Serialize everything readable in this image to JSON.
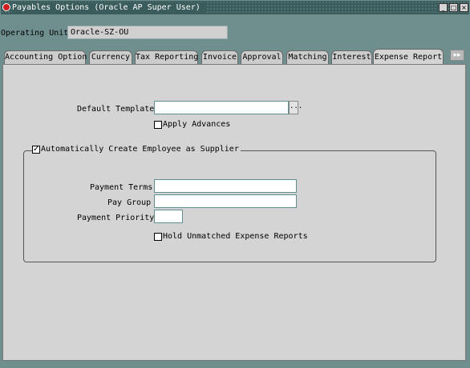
{
  "window": {
    "title": "Payables Options (Oracle AP Super User)",
    "logo": "oracle-logo-icon",
    "controls": [
      "minimize-icon",
      "maximize-icon",
      "close-icon"
    ]
  },
  "operating_unit": {
    "label": "Operating Unit",
    "value": "Oracle-SZ-OU"
  },
  "tabs": [
    {
      "label": "Accounting Option",
      "active": false
    },
    {
      "label": "Currency",
      "active": false
    },
    {
      "label": "Tax Reporting",
      "active": false
    },
    {
      "label": "Invoice",
      "active": false
    },
    {
      "label": "Approval",
      "active": false
    },
    {
      "label": "Matching",
      "active": false
    },
    {
      "label": "Interest",
      "active": false
    },
    {
      "label": "Expense Report",
      "active": true
    }
  ],
  "tab_scroll_icon": "next-tabs-icon",
  "form": {
    "default_template": {
      "label": "Default Template",
      "value": "",
      "lov_label": "..."
    },
    "apply_advances": {
      "label": "Apply Advances",
      "checked": false
    },
    "auto_create_supplier": {
      "label": "Automatically Create Employee as Supplier",
      "checked": true,
      "check_glyph": "✓"
    },
    "payment_terms": {
      "label": "Payment Terms",
      "value": ""
    },
    "pay_group": {
      "label": "Pay Group",
      "value": ""
    },
    "payment_priority": {
      "label": "Payment Priority",
      "value": ""
    },
    "hold_unmatched": {
      "label": "Hold Unmatched Expense Reports",
      "checked": false
    }
  }
}
